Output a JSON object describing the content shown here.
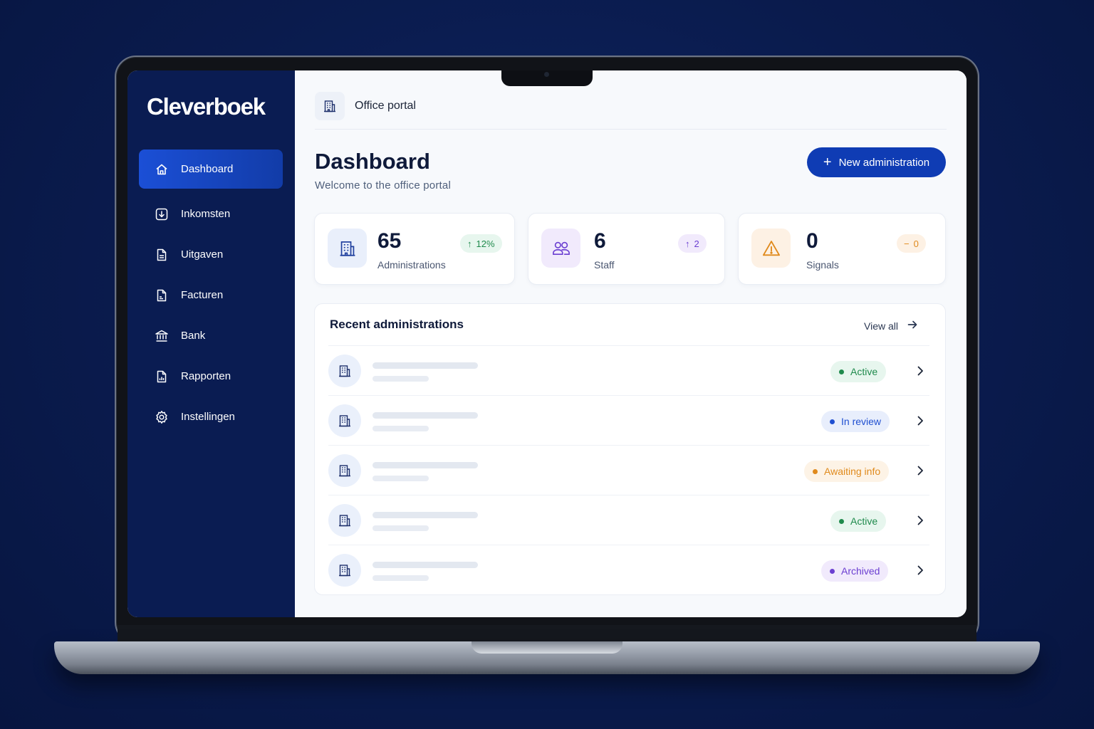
{
  "brand": {
    "logo": "Cleverboek"
  },
  "sidebar": {
    "items": [
      {
        "label": "Dashboard",
        "icon": "home-icon",
        "active": true
      },
      {
        "label": "Inkomsten",
        "icon": "download-icon"
      },
      {
        "label": "Uitgaven",
        "icon": "document-icon"
      },
      {
        "label": "Facturen",
        "icon": "invoice-icon"
      },
      {
        "label": "Bank",
        "icon": "bank-icon"
      },
      {
        "label": "Rapporten",
        "icon": "report-icon"
      },
      {
        "label": "Instellingen",
        "icon": "gear-icon"
      }
    ]
  },
  "topbar": {
    "title": "Office portal",
    "icon": "building-icon"
  },
  "header": {
    "title": "Dashboard",
    "subtitle": "Welcome to the office portal",
    "new_button": "New administration"
  },
  "stats": [
    {
      "value": "65",
      "label": "Administrations",
      "badge": "12%",
      "badge_prefix": "↑",
      "icon": "building-icon",
      "color": "#1f8a4c"
    },
    {
      "value": "6",
      "label": "Staff",
      "badge": "2",
      "badge_prefix": "↑",
      "icon": "users-icon",
      "color": "#6b3fd1"
    },
    {
      "value": "0",
      "label": "Signals",
      "badge": "0",
      "badge_prefix": "−",
      "icon": "warning-icon",
      "color": "#e08a1c"
    }
  ],
  "recent": {
    "title": "Recent administrations",
    "view_all": "View all",
    "rows": [
      {
        "status": "Active"
      },
      {
        "status": "In review"
      },
      {
        "status": "Awaiting info"
      },
      {
        "status": "Active"
      },
      {
        "status": "Archived"
      }
    ]
  },
  "colors": {
    "sidebar_bg": "#0a1c52",
    "accent": "#0f3cb4",
    "status_active": "#1f8a4c",
    "status_review": "#1f4fd1",
    "status_awaiting": "#e08a1c",
    "status_archived": "#6b3fd1"
  }
}
